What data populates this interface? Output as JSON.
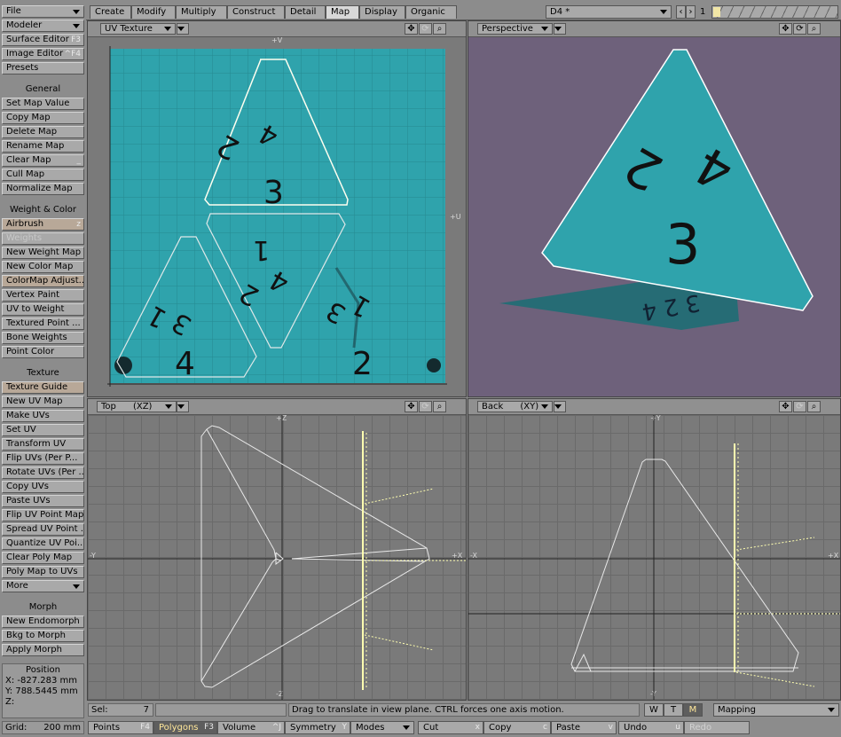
{
  "sidebar": {
    "items": [
      {
        "label": "File",
        "kind": "dropdown"
      },
      {
        "label": "Modeler",
        "kind": "dropdown"
      },
      {
        "label": "Surface Editor",
        "hotkey": "F3"
      },
      {
        "label": "Image Editor",
        "hotkey": "^F4"
      },
      {
        "label": "Presets"
      }
    ],
    "general_header": "General",
    "general": [
      {
        "label": "Set Map Value"
      },
      {
        "label": "Copy Map"
      },
      {
        "label": "Delete Map"
      },
      {
        "label": "Rename Map"
      },
      {
        "label": "Clear Map",
        "hotkey": "_"
      },
      {
        "label": "Cull Map"
      },
      {
        "label": "Normalize Map"
      }
    ],
    "weight_header": "Weight & Color",
    "weight": [
      {
        "label": "Airbrush",
        "hotkey": "z"
      },
      {
        "label": "Weights"
      },
      {
        "label": "New Weight Map"
      },
      {
        "label": "New Color Map"
      },
      {
        "label": "ColorMap Adjust..."
      },
      {
        "label": "Vertex Paint"
      },
      {
        "label": "UV to Weight"
      },
      {
        "label": "Textured Point ..."
      },
      {
        "label": "Bone Weights"
      },
      {
        "label": "Point Color"
      }
    ],
    "texture_header": "Texture",
    "texture": [
      {
        "label": "Texture Guide"
      },
      {
        "label": "New UV Map"
      },
      {
        "label": "Make UVs"
      },
      {
        "label": "Set UV"
      },
      {
        "label": "Transform UV"
      },
      {
        "label": "Flip UVs (Per P..."
      },
      {
        "label": "Rotate UVs (Per ..."
      },
      {
        "label": "Copy UVs"
      },
      {
        "label": "Paste UVs"
      },
      {
        "label": "Flip UV Point Map"
      },
      {
        "label": "Spread UV Point ..."
      },
      {
        "label": "Quantize UV Poi..."
      },
      {
        "label": "Clear Poly Map"
      },
      {
        "label": "Poly Map to UVs"
      },
      {
        "label": "More"
      }
    ],
    "morph_header": "Morph",
    "morph": [
      {
        "label": "New Endomorph"
      },
      {
        "label": "Bkg to Morph"
      },
      {
        "label": "Apply Morph"
      }
    ],
    "position": {
      "title": "Position",
      "x": "X:  -827.283 mm",
      "y": "Y:  788.5445 mm",
      "z": "Z:"
    },
    "grid": {
      "label": "Grid:",
      "value": "200 mm"
    }
  },
  "tabs": [
    "Create",
    "Modify",
    "Multiply",
    "Construct",
    "Detail",
    "Map",
    "Display",
    "Organic"
  ],
  "active_tab": "Map",
  "object": {
    "name": "D4 *",
    "layer": "1"
  },
  "viewports": {
    "uv": {
      "mode": "UV Texture",
      "axis_top": "+V",
      "axis_right": "+U"
    },
    "perspective": {
      "mode": "Perspective"
    },
    "top": {
      "mode": "Top",
      "plane": "(XZ)",
      "axis_top": "+Z",
      "axis_bottom": "-Z",
      "axis_left": "-Y",
      "axis_right": "+X"
    },
    "back": {
      "mode": "Back",
      "plane": "(XY)",
      "axis_top": "+Y",
      "axis_bottom": "-Y",
      "axis_left": "-X",
      "axis_right": "+X"
    }
  },
  "uv_labels": [
    "2",
    "4",
    "3",
    "1",
    "2",
    "4",
    "1",
    "3",
    "4",
    "3",
    "1",
    "2"
  ],
  "status": {
    "sel_label": "Sel:",
    "sel_count": "7",
    "message": "Drag to translate in view plane. CTRL forces one axis motion.",
    "wtm": [
      "W",
      "T",
      "M"
    ],
    "mapping": "Mapping"
  },
  "bottom": [
    {
      "label": "Points",
      "hotkey": "F4"
    },
    {
      "label": "Polygons",
      "hotkey": "F3"
    },
    {
      "label": "Volume",
      "hotkey": "^J"
    },
    {
      "label": "Symmetry",
      "hotkey": "Y"
    },
    {
      "label": "Modes"
    },
    {
      "label": "Cut",
      "hotkey": "x"
    },
    {
      "label": "Copy",
      "hotkey": "c"
    },
    {
      "label": "Paste",
      "hotkey": "v"
    },
    {
      "label": "Undo",
      "hotkey": "u"
    },
    {
      "label": "Redo"
    }
  ],
  "colors": {
    "uv_bg": "#2fa3ac",
    "persp_bg": "#6e617b",
    "wire": "#e0e0e0",
    "selected": "#ffffb0"
  }
}
